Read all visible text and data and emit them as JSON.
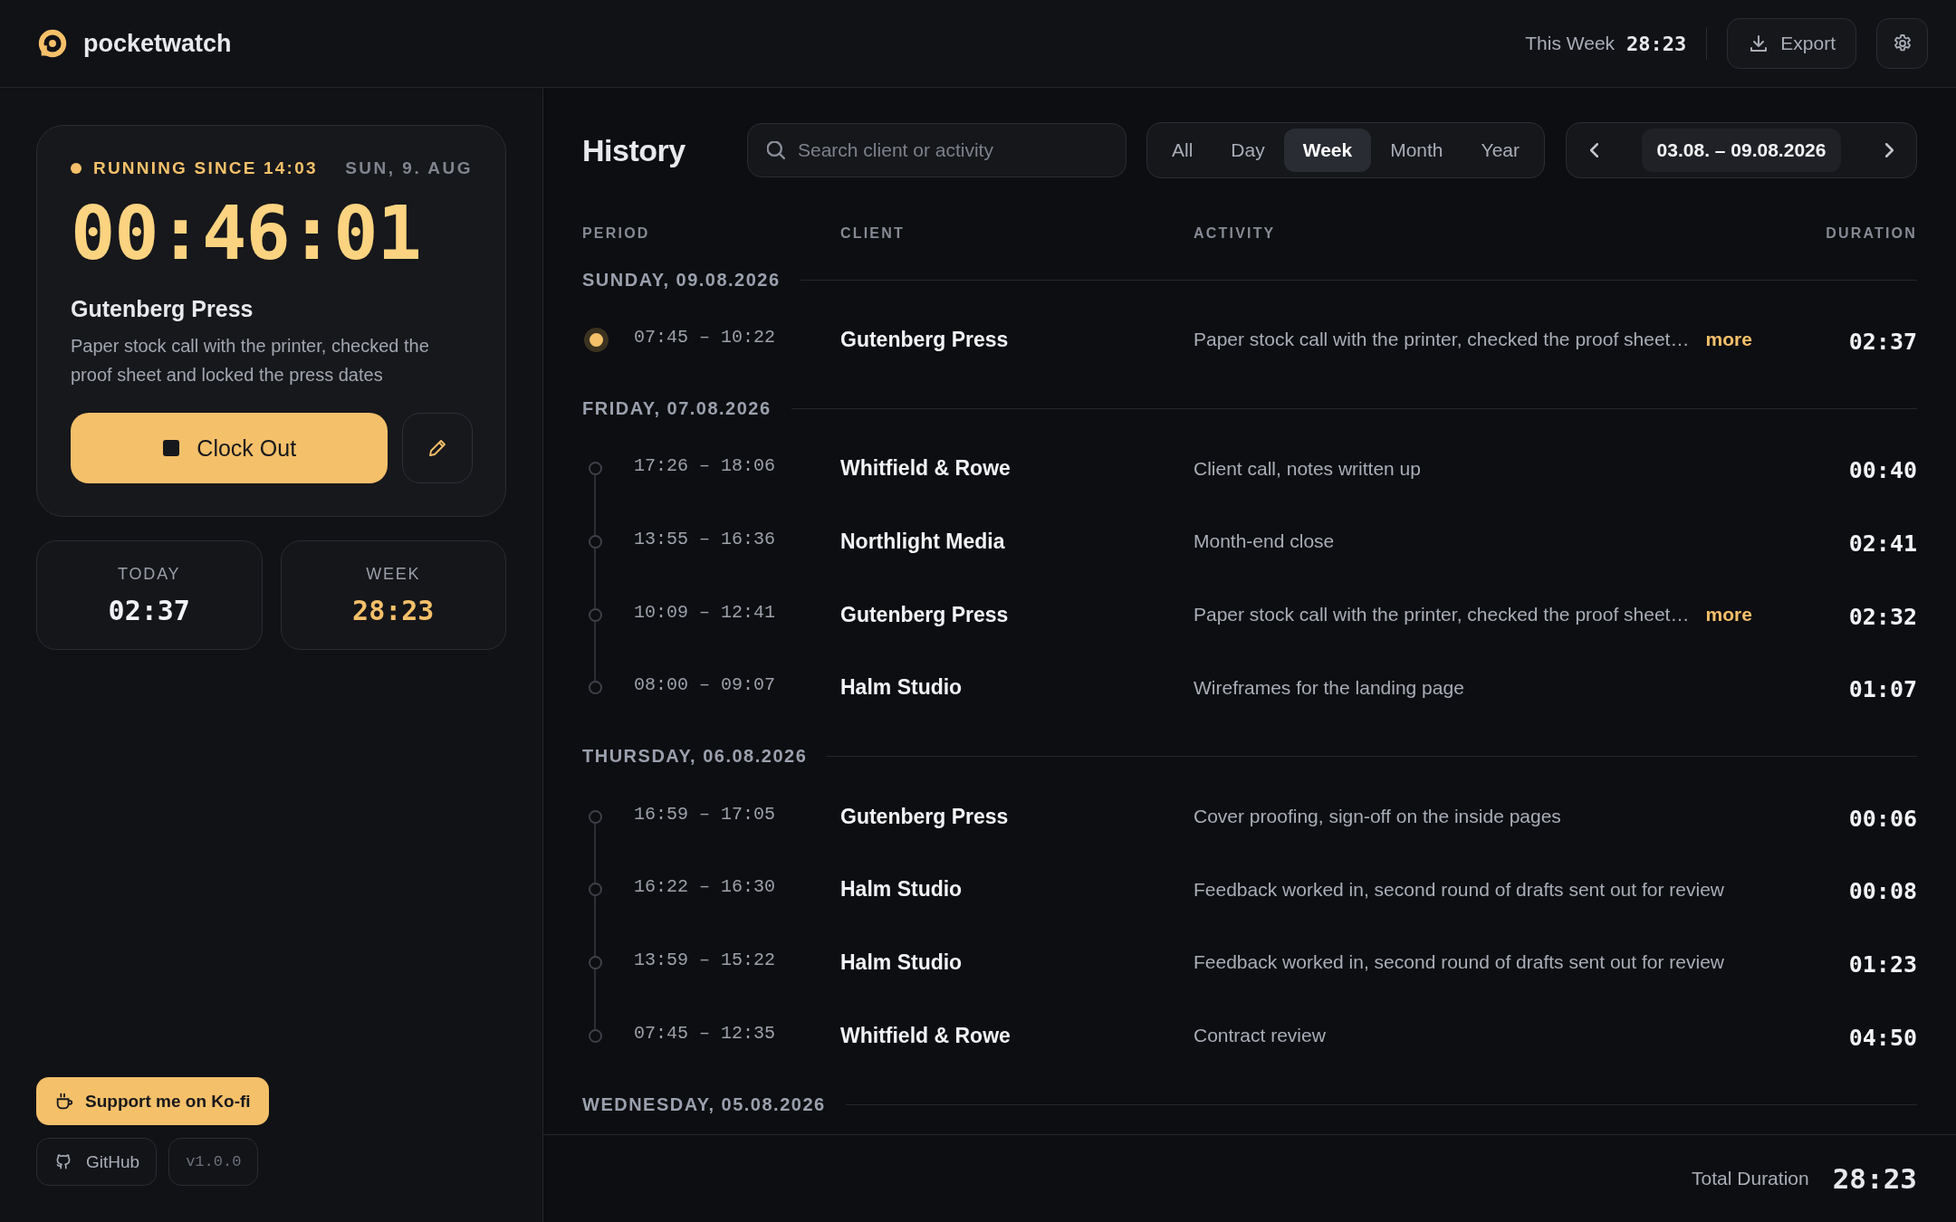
{
  "app": {
    "name": "pocketwatch"
  },
  "header": {
    "week_label": "This Week",
    "week_total": "28:23",
    "export_label": "Export"
  },
  "timer": {
    "status": "RUNNING SINCE 14:03",
    "running": true,
    "date": "SUN, 9. AUG",
    "elapsed": "00:46:01",
    "client": "Gutenberg Press",
    "activity": "Paper stock call with the printer, checked the proof sheet and locked the press dates",
    "clock_out_label": "Clock Out"
  },
  "stats": [
    {
      "label": "TODAY",
      "value": "02:37",
      "highlight": false
    },
    {
      "label": "WEEK",
      "value": "28:23",
      "highlight": true
    }
  ],
  "links": {
    "kofi": "Support me on Ko-fi",
    "github": "GitHub",
    "version": "v1.0.0"
  },
  "history": {
    "title": "History",
    "search": {
      "placeholder": "Search client or activity"
    },
    "ranges": [
      {
        "label": "All",
        "selected": false
      },
      {
        "label": "Day",
        "selected": false
      },
      {
        "label": "Week",
        "selected": true
      },
      {
        "label": "Month",
        "selected": false
      },
      {
        "label": "Year",
        "selected": false
      }
    ],
    "date_range": "03.08. – 09.08.2026",
    "columns": [
      "PERIOD",
      "CLIENT",
      "ACTIVITY",
      "DURATION"
    ],
    "days": [
      {
        "label": "SUNDAY, 09.08.2026",
        "entries": [
          {
            "period": "07:45 – 10:22",
            "client": "Gutenberg Press",
            "activity": "Paper stock call with the printer, checked the proof sheet…",
            "more": "more",
            "duration": "02:37",
            "running": true
          }
        ]
      },
      {
        "label": "FRIDAY, 07.08.2026",
        "entries": [
          {
            "period": "17:26 – 18:06",
            "client": "Whitfield & Rowe",
            "activity": "Client call, notes written up",
            "duration": "00:40",
            "running": false
          },
          {
            "period": "13:55 – 16:36",
            "client": "Northlight Media",
            "activity": "Month-end close",
            "duration": "02:41",
            "running": false
          },
          {
            "period": "10:09 – 12:41",
            "client": "Gutenberg Press",
            "activity": "Paper stock call with the printer, checked the proof sheet…",
            "more": "more",
            "duration": "02:32",
            "running": false
          },
          {
            "period": "08:00 – 09:07",
            "client": "Halm Studio",
            "activity": "Wireframes for the landing page",
            "duration": "01:07",
            "running": false
          }
        ]
      },
      {
        "label": "THURSDAY, 06.08.2026",
        "entries": [
          {
            "period": "16:59 – 17:05",
            "client": "Gutenberg Press",
            "activity": "Cover proofing, sign-off on the inside pages",
            "duration": "00:06",
            "running": false
          },
          {
            "period": "16:22 – 16:30",
            "client": "Halm Studio",
            "activity": "Feedback worked in, second round of drafts sent out for review",
            "duration": "00:08",
            "running": false
          },
          {
            "period": "13:59 – 15:22",
            "client": "Halm Studio",
            "activity": "Feedback worked in, second round of drafts sent out for review",
            "duration": "01:23",
            "running": false
          },
          {
            "period": "07:45 – 12:35",
            "client": "Whitfield & Rowe",
            "activity": "Contract review",
            "duration": "04:50",
            "running": false
          }
        ]
      },
      {
        "label": "WEDNESDAY, 05.08.2026"
      }
    ]
  },
  "footer": {
    "total_label": "Total Duration",
    "total": "28:23"
  }
}
